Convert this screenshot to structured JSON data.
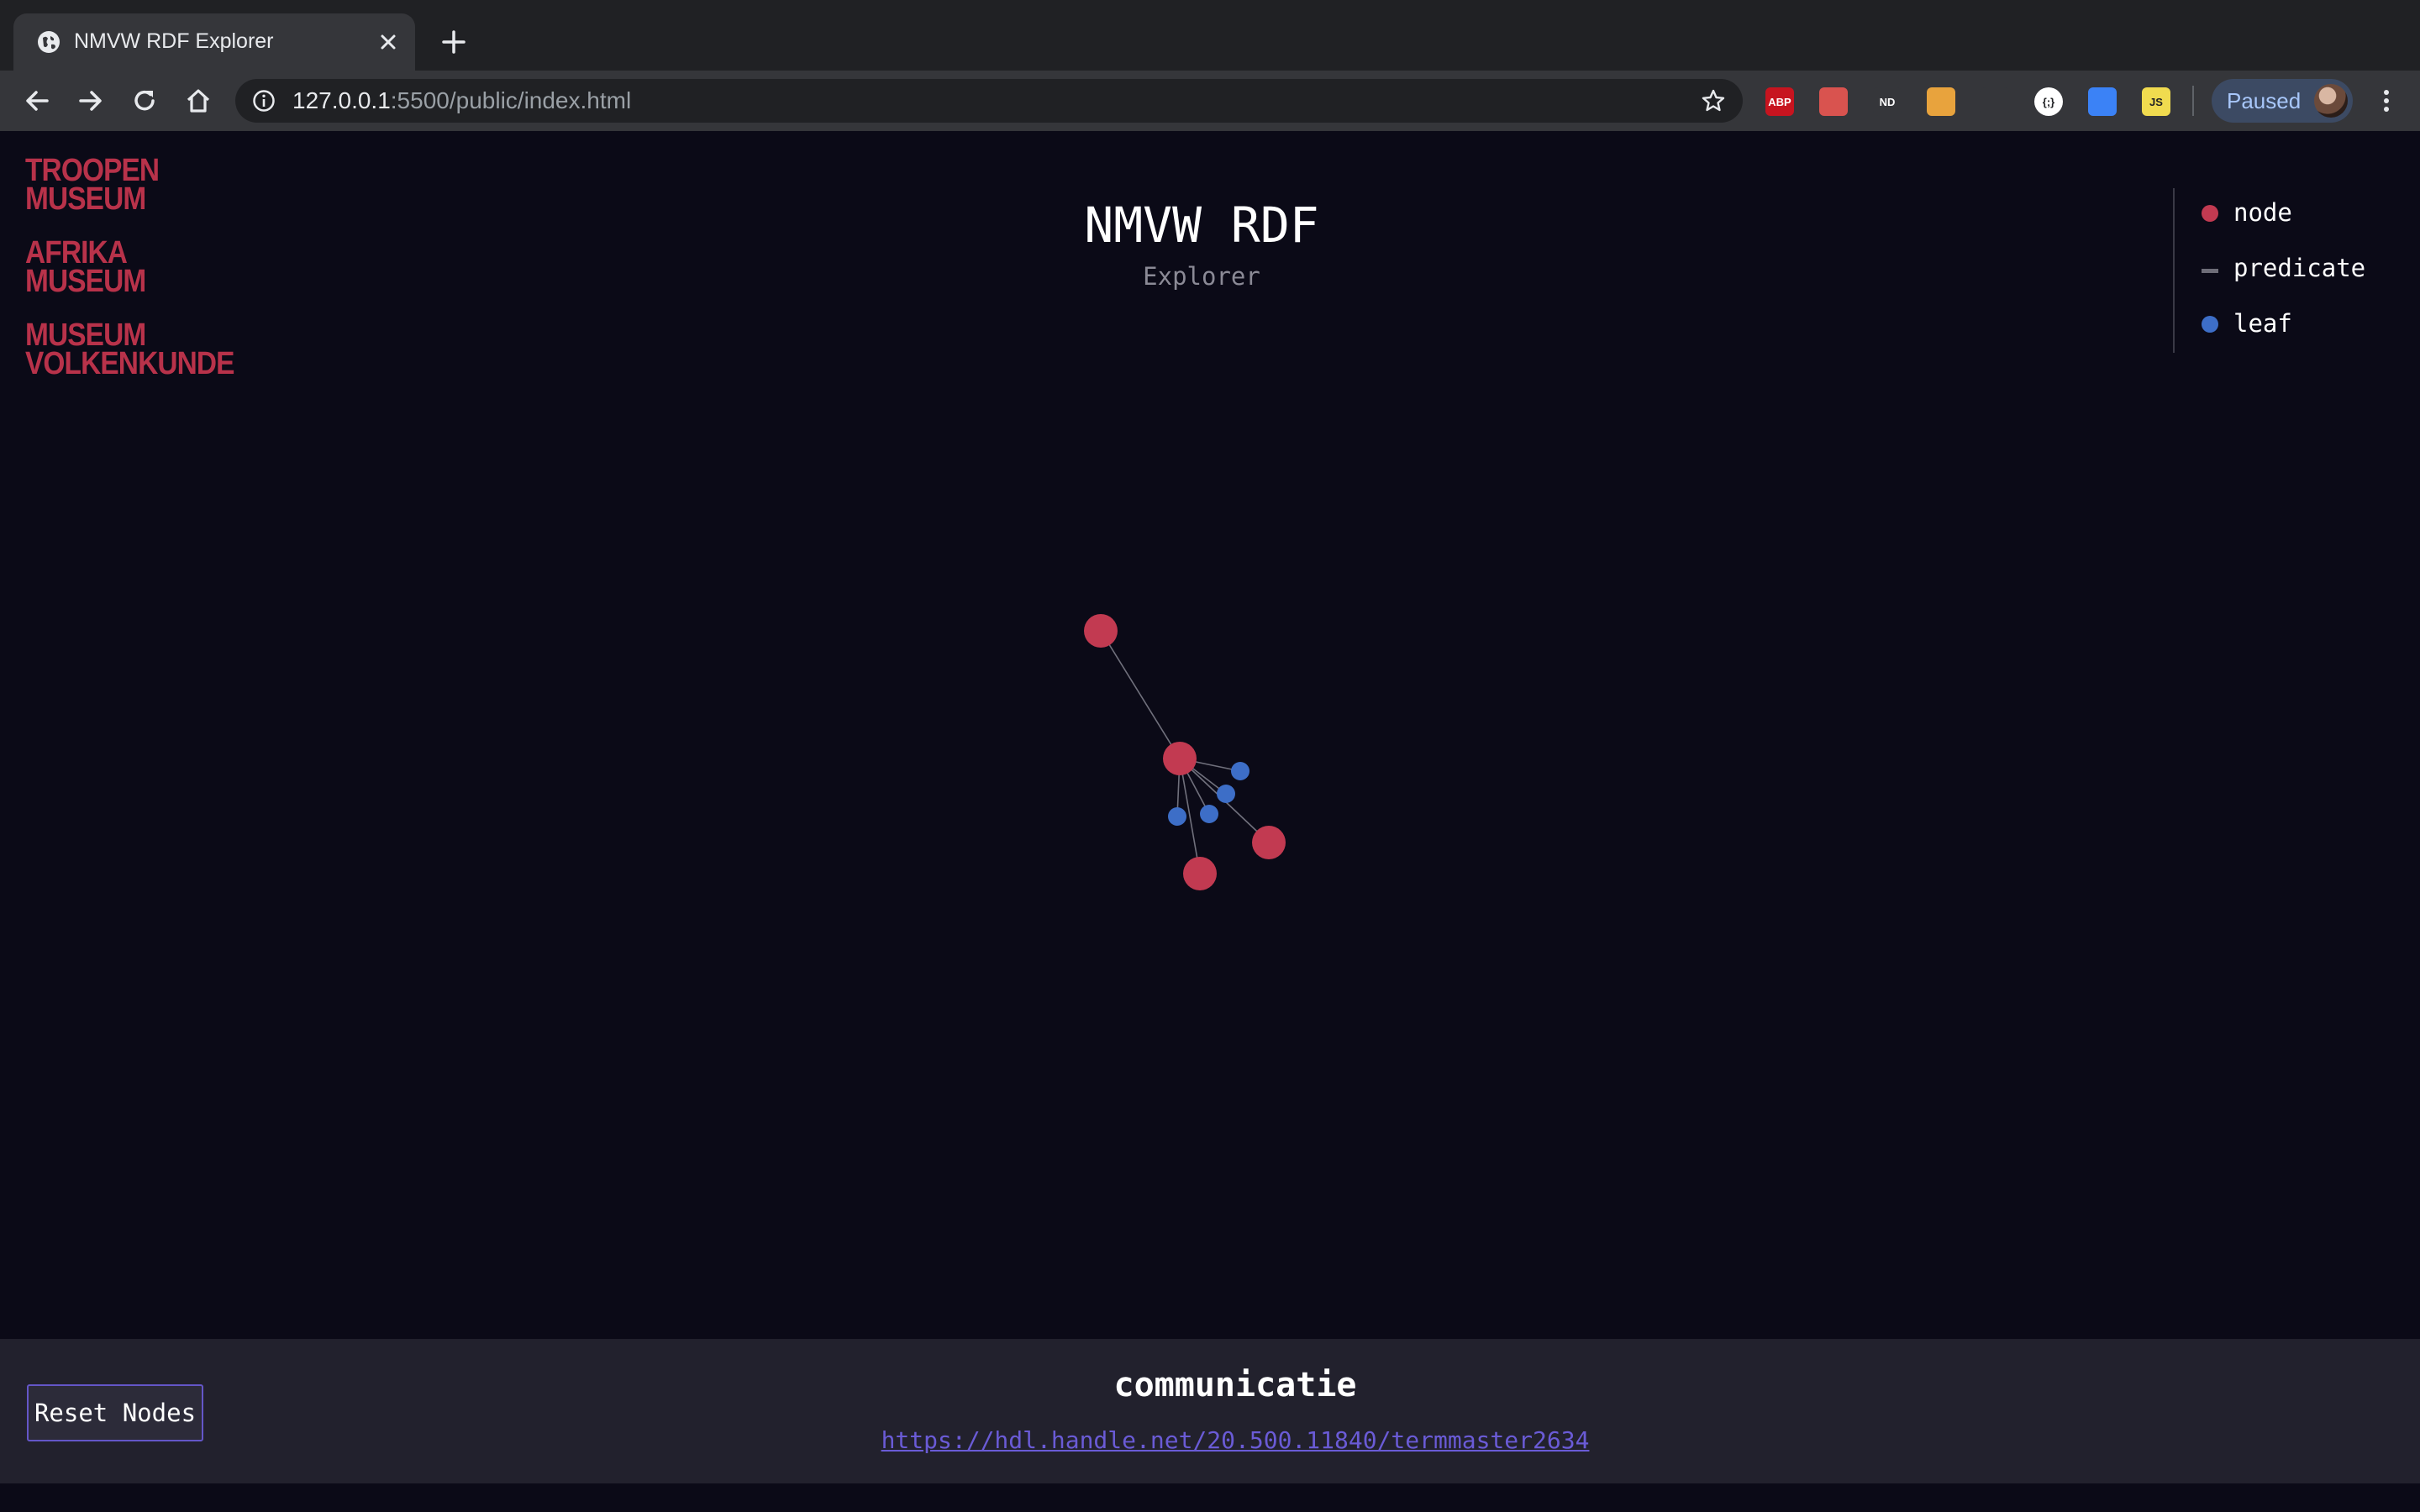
{
  "browser": {
    "tab_title": "NMVW RDF Explorer",
    "url_host": "127.0.0.1",
    "url_rest": ":5500/public/index.html",
    "profile_label": "Paused",
    "extensions": [
      {
        "name": "adblock-plus-icon",
        "label": "ABP",
        "color": "#c7141f"
      },
      {
        "name": "gmail-checker-icon",
        "label": "",
        "color": "#d9534f"
      },
      {
        "name": "nd-extension-icon",
        "label": "ND",
        "color": "#35363a"
      },
      {
        "name": "color-picker-icon",
        "label": "",
        "color": "#e8a33d"
      },
      {
        "name": "sync-extension-icon",
        "label": "",
        "color": "#35363a"
      },
      {
        "name": "json-viewer-icon",
        "label": "{;}",
        "color": "#ffffff"
      },
      {
        "name": "refresh-extension-icon",
        "label": "",
        "color": "#3b82f6"
      },
      {
        "name": "js-extension-icon",
        "label": "JS",
        "color": "#f0db4f"
      }
    ]
  },
  "logos": [
    {
      "lines": [
        "TROOPEN",
        "MUSEUM"
      ]
    },
    {
      "lines": [
        "AFRIKA",
        "MUSEUM"
      ]
    },
    {
      "lines": [
        "MUSEUM",
        "VOLKENKUNDE"
      ]
    }
  ],
  "header": {
    "title": "NMVW RDF",
    "subtitle": "Explorer"
  },
  "legend": {
    "items": [
      {
        "label": "node",
        "kind": "dot",
        "color": "#c23a51"
      },
      {
        "label": "predicate",
        "kind": "dash",
        "color": "#6e6d78"
      },
      {
        "label": "leaf",
        "kind": "dot",
        "color": "#3d6ec7"
      }
    ]
  },
  "graph": {
    "node_color": "#c23a51",
    "leaf_color": "#3d6ec7",
    "link_color": "#8a8996"
  },
  "panel": {
    "reset_label": "Reset Nodes",
    "selected_name": "communicatie",
    "selected_uri": "https://hdl.handle.net/20.500.11840/termmaster2634"
  }
}
